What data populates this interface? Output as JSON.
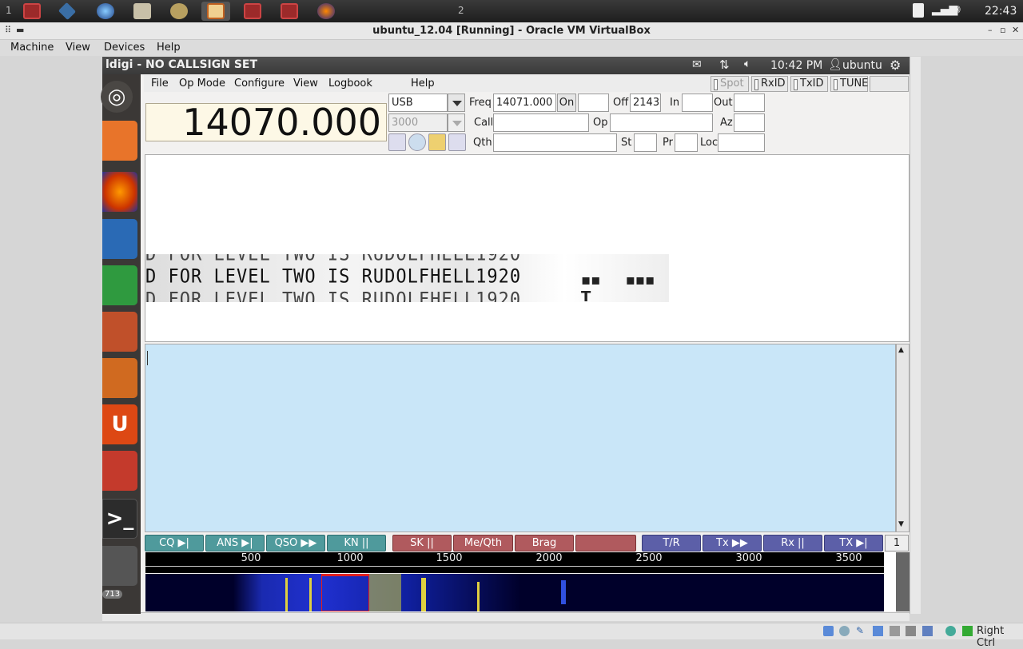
{
  "host_panel": {
    "workspace_left": "1",
    "workspace_right": "2",
    "clock": "22:43",
    "apps": [
      "app-red-1",
      "virtualbox-icon",
      "settings-globe-icon",
      "files-folder-icon",
      "gimp-icon",
      "fldigi-icon",
      "app-red-2",
      "app-red-3",
      "badge-icon"
    ]
  },
  "vbox": {
    "title": "ubuntu_12.04 [Running] - Oracle VM VirtualBox",
    "menus": [
      "Machine",
      "View",
      "Devices",
      "Help"
    ],
    "host_key": "Right Ctrl"
  },
  "guest_topbar": {
    "window_title": "ldigi - NO CALLSIGN SET",
    "time": "10:42 PM",
    "user": "ubuntu"
  },
  "launcher": {
    "badge": "713"
  },
  "fldigi": {
    "menus": [
      "File",
      "Op Mode",
      "Configure",
      "View",
      "Logbook",
      "Help"
    ],
    "buttons": {
      "spot": "Spot",
      "rxid": "RxID",
      "txid": "TxID",
      "tune": "TUNE"
    },
    "frequency": "14070.000",
    "mode": "USB",
    "bandwidth": "3000",
    "labels": {
      "freq": "Freq",
      "on": "On",
      "off": "Off",
      "in": "In",
      "out": "Out",
      "call": "Call",
      "op": "Op",
      "az": "Az",
      "qth": "Qth",
      "st": "St",
      "pr": "Pr",
      "loc": "Loc"
    },
    "values": {
      "freq": "14071.000",
      "off": "2143",
      "on": "",
      "in": "",
      "out": "",
      "call": "",
      "op": "",
      "az": "",
      "qth": "",
      "st": "",
      "pr": "",
      "loc": ""
    },
    "rx_lines": [
      "D FOR LEVEL TWO IS RUDOLFHELL1920",
      "D FOR LEVEL TWO IS RUDOLFHELL1920",
      "D FOR LEVEL TWO IS RUDOLFHELL1920"
    ],
    "macros": [
      {
        "label": "CQ ▶|",
        "color": "g"
      },
      {
        "label": "ANS ▶|",
        "color": "g"
      },
      {
        "label": "QSO ▶▶",
        "color": "g"
      },
      {
        "label": "KN ||",
        "color": "g"
      },
      {
        "label": "SK ||",
        "color": "r"
      },
      {
        "label": "Me/Qth",
        "color": "r"
      },
      {
        "label": "Brag",
        "color": "r"
      },
      {
        "label": "",
        "color": "r"
      },
      {
        "label": "T/R",
        "color": "b"
      },
      {
        "label": "Tx ▶▶",
        "color": "b"
      },
      {
        "label": "Rx ||",
        "color": "b"
      },
      {
        "label": "TX ▶|",
        "color": "b"
      }
    ],
    "macro_set": "1",
    "scale_ticks": [
      "500",
      "1000",
      "1500",
      "2000",
      "2500",
      "3000",
      "3500"
    ]
  }
}
